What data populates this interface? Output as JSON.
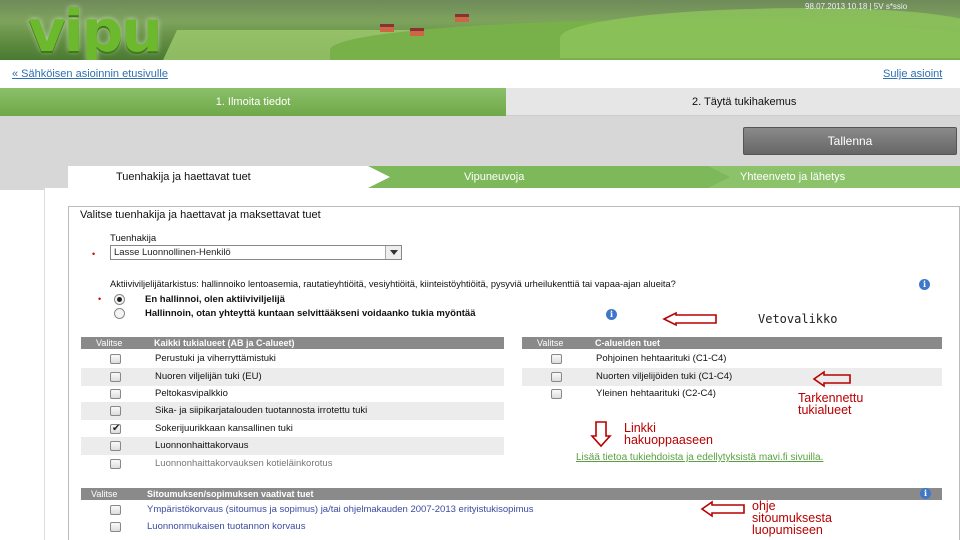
{
  "header": {
    "logo_text": "vipu",
    "top_info": "98.07.2013 10.18  |  5V   s*ssio"
  },
  "links": {
    "back": "« Sähköisen asioinnin etusivulle",
    "close": "Sulje asioint"
  },
  "steps": [
    {
      "label": "1. Ilmoita tiedot"
    },
    {
      "label": "2. Täytä tukihakemus"
    }
  ],
  "toolbar": {
    "save_label": "Tallenna"
  },
  "tabs": [
    {
      "label": "Tuenhakija ja haettavat tuet"
    },
    {
      "label": "Vipuneuvoja"
    },
    {
      "label": "Yhteenveto ja lähetys"
    }
  ],
  "form": {
    "title": "Valitse tuenhakija ja haettavat ja maksettavat tuet",
    "applicant_label": "Tuenhakija",
    "applicant_value": "Lasse Luonnollinen-Henkilö",
    "active_farmer_text": "Aktiiviviljelijätarkistus: hallinnoiko lentoasemia, rautatieyhtiöitä, vesiyhtiöitä, kiinteistöyhtiöitä, pysyviä urheilukenttiä tai vapaa-ajan alueita?",
    "radio1": "En hallinnoi, olen aktiiviviljelijä",
    "radio2": "Hallinnoin, otan yhteyttä kuntaan selvittääkseni voidaanko tukia myöntää"
  },
  "left_table": {
    "col_select": "Valitse",
    "col_title": "Kaikki tukialueet (AB ja C-alueet)",
    "rows": [
      {
        "label": "Perustuki ja viherryttämistuki",
        "checked": false
      },
      {
        "label": "Nuoren viljelijän tuki (EU)",
        "checked": false
      },
      {
        "label": "Peltokasvipalkkio",
        "checked": false
      },
      {
        "label": "Sika- ja siipikarjatalouden tuotannosta irrotettu tuki",
        "checked": false
      },
      {
        "label": "Sokerijuurikkaan kansallinen tuki",
        "checked": true
      },
      {
        "label": "Luonnonhaittakorvaus",
        "checked": false
      },
      {
        "label": "Luonnonhaittakorvauksen kotieläinkorotus",
        "checked": false
      }
    ]
  },
  "right_table": {
    "col_select": "Valitse",
    "col_title": "C-alueiden tuet",
    "rows": [
      {
        "label": "Pohjoinen hehtaarituki (C1-C4)"
      },
      {
        "label": "Nuorten viljelijöiden tuki (C1-C4)"
      },
      {
        "label": "Yleinen hehtaarituki (C2-C4)"
      }
    ]
  },
  "more_info_link": "Lisää tietoa tukiehdoista ja edellytyksistä mavi.fi sivuilla.",
  "commitments_table": {
    "col_select": "Valitse",
    "col_title": "Sitoumuksen/sopimuksen vaativat tuet",
    "rows": [
      {
        "label": "Ympäristökorvaus (sitoumus ja sopimus) ja/tai ohjelmakauden 2007-2013 erityistukisopimus"
      },
      {
        "label": "Luonnonmukaisen tuotannon korvaus"
      }
    ]
  },
  "annotations": {
    "dropdown": "Vetovalikko",
    "specified": [
      "Tarkennettu",
      "tukialueet"
    ],
    "link": [
      "Linkki",
      "hakuoppaaseen"
    ],
    "guide": [
      "ohje",
      "sitoumuksesta",
      "luopumiseen"
    ]
  },
  "colors": {
    "green_step": "#6ea848",
    "link_blue": "#2f6fb2",
    "annotation_red": "#b80000"
  }
}
